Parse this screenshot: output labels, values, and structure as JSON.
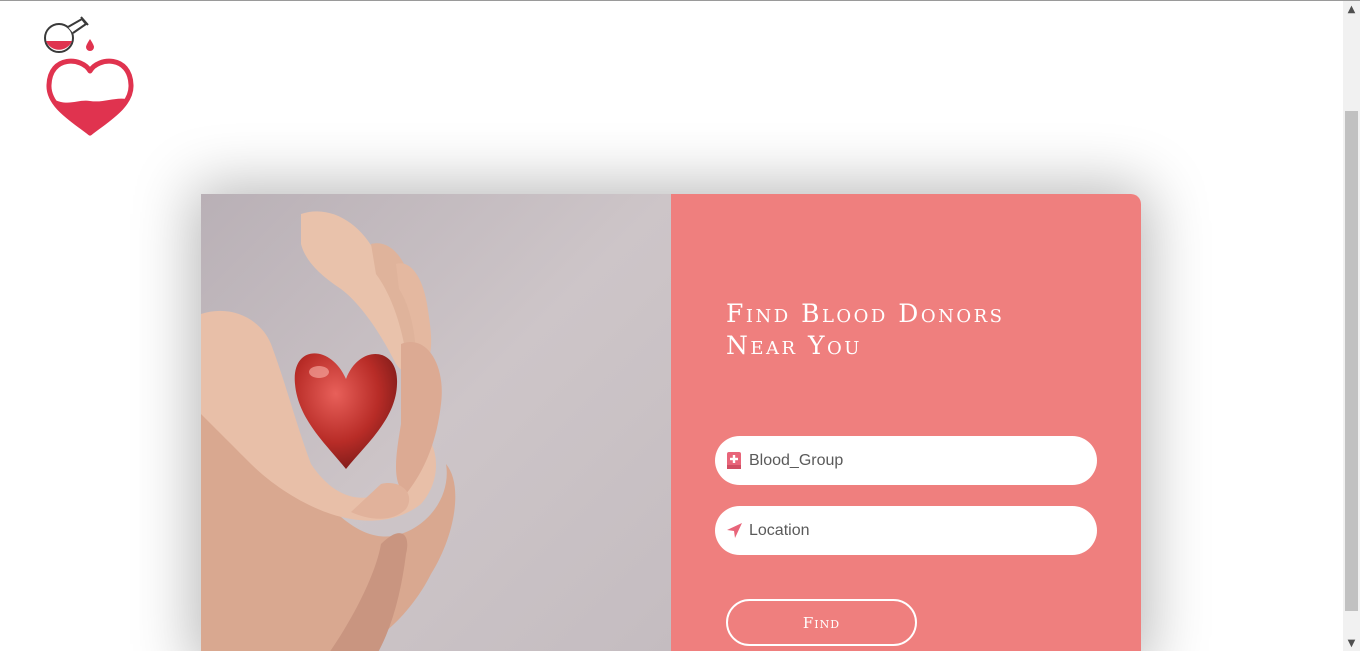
{
  "panel": {
    "title": "Find Blood Donors Near You"
  },
  "form": {
    "blood_group": {
      "placeholder": "Blood_Group",
      "value": "",
      "icon": "medical-book-icon"
    },
    "location": {
      "placeholder": "Location",
      "value": "",
      "icon": "location-arrow-icon"
    },
    "find_label": "Find"
  },
  "colors": {
    "panel_bg": "#ef7f7e",
    "brand_red": "#e0334f",
    "icon_pink": "#e8657a"
  }
}
